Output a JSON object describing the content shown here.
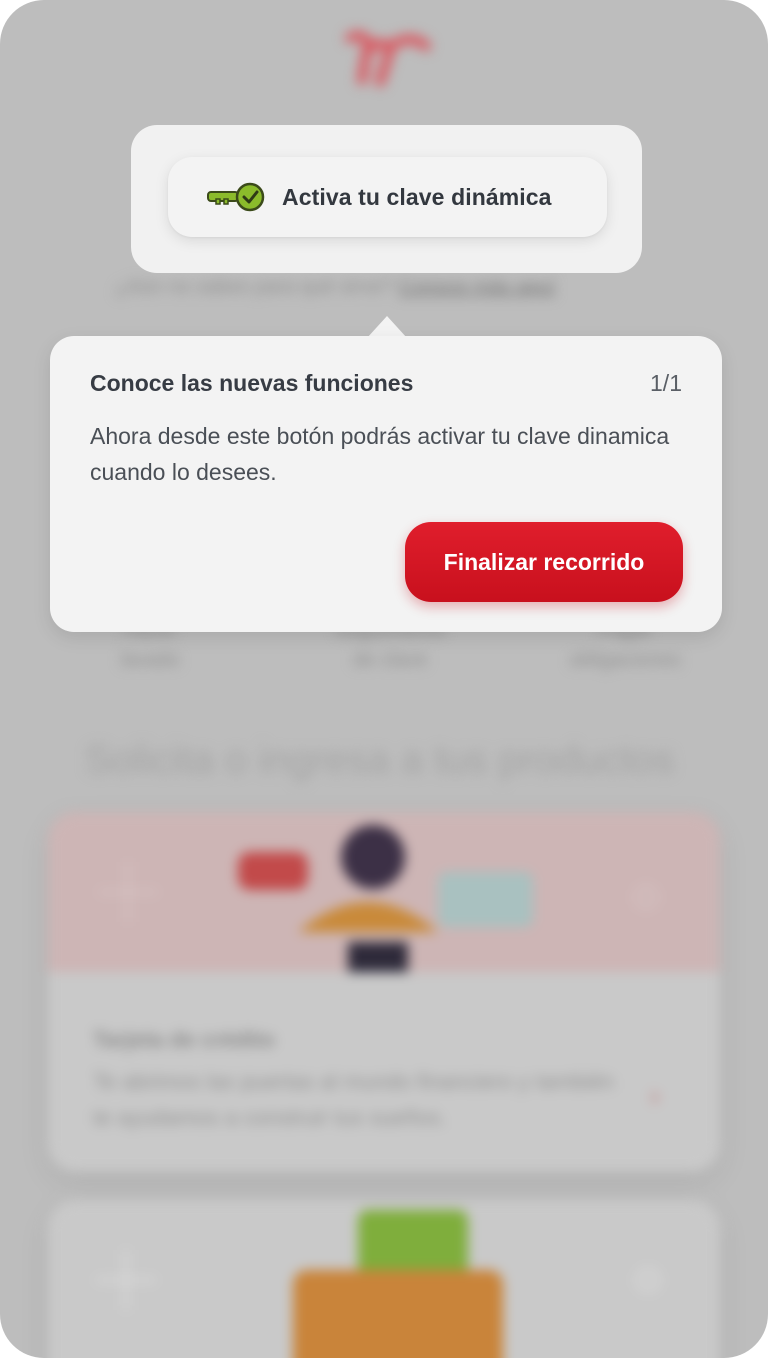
{
  "background": {
    "help_text": "¿Aún no sabes para qué sirve?",
    "help_link": "Conoce más aquí",
    "shortcuts": [
      {
        "label": "Hacer\nlavado"
      },
      {
        "label": "Seguimiento\nde clave"
      },
      {
        "label": "Pagar\nobligaciones"
      }
    ],
    "section_title": "Solicita o ingresa a tus productos",
    "cards": [
      {
        "title": "Tarjeta de crédito",
        "description": "Te abrimos las puertas al mundo financiero y también te ayudamos a construir tus sueños."
      }
    ],
    "chevron": "›"
  },
  "activate_button": {
    "label": "Activa tu clave dinámica",
    "icon": "key-check-icon"
  },
  "tooltip": {
    "title": "Conoce las nuevas funciones",
    "counter": "1/1",
    "body": "Ahora desde este botón podrás activar tu clave dinamica cuando lo desees.",
    "finish_label": "Finalizar recorrido"
  },
  "colors": {
    "accent": "#d7141f",
    "key_green": "#8bbb2b",
    "overlay": "#bdbdbd"
  }
}
